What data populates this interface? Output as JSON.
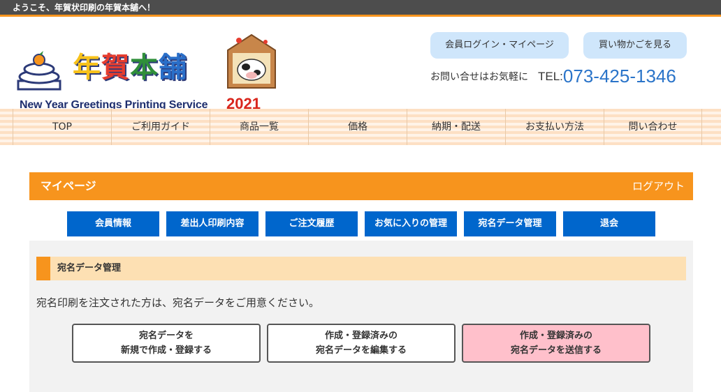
{
  "topbar": {
    "welcome": "ようこそ、年賀状印刷の年賀本舗へ！"
  },
  "logo": {
    "title_chars": [
      "年",
      "賀",
      "本",
      "舗"
    ],
    "title_colors": [
      "#f7c21b",
      "#e63d2f",
      "#2f8f3a",
      "#2a6fc9"
    ],
    "subtitle": "New Year Greetings Printing Service",
    "year": "2021"
  },
  "header": {
    "login_button": "会員ログイン・マイページ",
    "cart_button": "買い物かごを見る",
    "contact_text": "お問い合せはお気軽に",
    "tel_label": "TEL:",
    "tel_number": "073-425-1346"
  },
  "nav": [
    "TOP",
    "ご利用ガイド",
    "商品一覧",
    "価格",
    "納期・配送",
    "お支払い方法",
    "問い合わせ"
  ],
  "mypage": {
    "title": "マイページ",
    "logout": "ログアウト"
  },
  "tabs": [
    "会員情報",
    "差出人印刷内容",
    "ご注文履歴",
    "お気に入りの管理",
    "宛名データ管理",
    "退会"
  ],
  "section": {
    "title": "宛名データ管理",
    "description": "宛名印刷を注文された方は、宛名データをご用意ください。"
  },
  "actions": [
    {
      "line1": "宛名データを",
      "line2": "新規で作成・登録する"
    },
    {
      "line1": "作成・登録済みの",
      "line2": "宛名データを編集する"
    },
    {
      "line1": "作成・登録済みの",
      "line2": "宛名データを送信する"
    }
  ],
  "colors": {
    "accent": "#f7941d",
    "tab_blue": "#0066cc",
    "pill_blue": "#cfe6fb",
    "send_pink": "#ffc0cb",
    "tel_blue": "#2a74c9"
  }
}
